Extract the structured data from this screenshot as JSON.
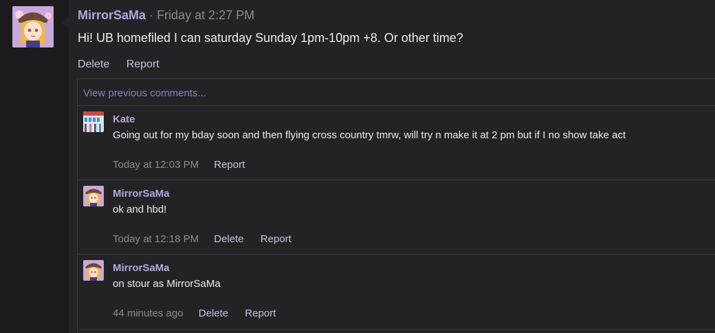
{
  "post": {
    "author": "MirrorSaMa",
    "separator": "·",
    "time": "Friday at 2:27 PM",
    "body": "Hi! UB homefiled I can saturday Sunday 1pm-10pm +8. Or other time?",
    "delete_label": "Delete",
    "report_label": "Report"
  },
  "comments": {
    "view_previous": "View previous comments...",
    "items": [
      {
        "author": "Kate",
        "text": "Going out for my bday soon and then flying cross country tmrw, will try n make it at 2 pm but if I no show take act",
        "time": "Today at 12:03 PM",
        "report_label": "Report"
      },
      {
        "author": "MirrorSaMa",
        "text": "ok and hbd!",
        "time": "Today at 12:18 PM",
        "delete_label": "Delete",
        "report_label": "Report"
      },
      {
        "author": "MirrorSaMa",
        "text": "on stour as MirrorSaMa",
        "time": "44 minutes ago",
        "delete_label": "Delete",
        "report_label": "Report"
      }
    ]
  }
}
